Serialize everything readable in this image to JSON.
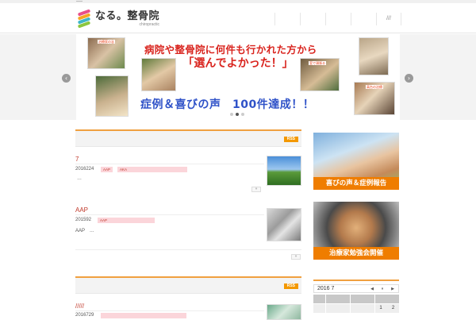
{
  "site": {
    "logo_text": "なる。整骨院",
    "logo_sub": "chiropractic",
    "nav_items": [
      "",
      "",
      "",
      "",
      "///"
    ]
  },
  "slider": {
    "prev_icon": "chevron-left-icon",
    "next_icon": "chevron-right-icon",
    "line1": "病院や整骨院に何件も行かれた方から",
    "line2": "「選んでよかった！」",
    "line3": "症例＆喜びの声　100件達成！！",
    "tag1": "治療家の念",
    "tag2": "室で頑張る",
    "tag3": "高台の治療",
    "dots": 3,
    "active_dot": 1
  },
  "news": {
    "rss_label": "RSS",
    "posts": [
      {
        "title": "7",
        "date": "2016224",
        "cats": [
          "AAP",
          "AKA"
        ],
        "excerpt": "…",
        "more": "»"
      },
      {
        "title": "AAP",
        "date": "201592",
        "cats": [
          "AAP"
        ],
        "excerpt": "AAP　…",
        "more": "»"
      }
    ],
    "list_more": "»"
  },
  "news2": {
    "rss_label": "RSS",
    "post_title": "/////",
    "post_date": "2016729"
  },
  "sidebar": {
    "banner1_caption": "喜びの声＆症例報告",
    "banner2_caption": "治療家勉強会開催"
  },
  "calendar": {
    "month_label": "2016 7",
    "prev": "◀",
    "pause": "⏸",
    "next": "▶",
    "cells": [
      "",
      "",
      "",
      "",
      "",
      "",
      "",
      "",
      "",
      "",
      "",
      "",
      "1",
      "2"
    ]
  },
  "colors": {
    "accent": "#f39800",
    "banner_red": "#d9241e",
    "banner_blue": "#2f52c8",
    "caption_orange": "#ef7d00"
  }
}
